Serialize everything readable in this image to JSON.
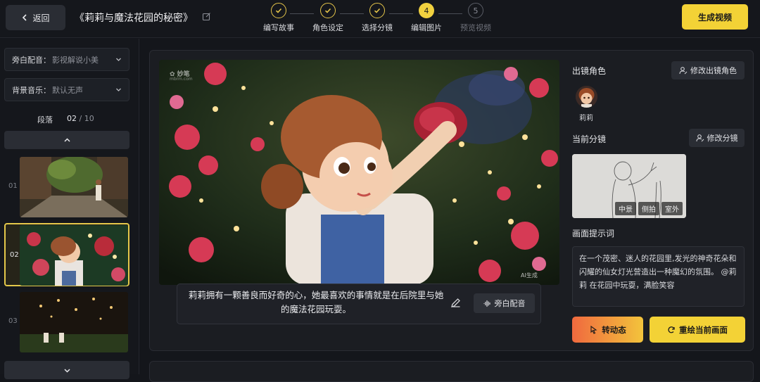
{
  "header": {
    "back_label": "返回",
    "title": "《莉莉与魔法花园的秘密》",
    "steps": [
      {
        "num": "",
        "label": "编写故事",
        "state": "done"
      },
      {
        "num": "",
        "label": "角色设定",
        "state": "done"
      },
      {
        "num": "",
        "label": "选择分镜",
        "state": "done"
      },
      {
        "num": "4",
        "label": "编辑图片",
        "state": "active"
      },
      {
        "num": "5",
        "label": "预览视频",
        "state": "todo"
      }
    ],
    "generate_label": "生成视频"
  },
  "sidebar": {
    "narration": {
      "key": "旁白配音：",
      "value": "影视解说小美"
    },
    "music": {
      "key": "背景音乐：",
      "value": "默认无声"
    },
    "segment_label": "段落",
    "segment_current": "02",
    "segment_total": " / 10",
    "thumbnails": [
      {
        "num": "01"
      },
      {
        "num": "02"
      },
      {
        "num": "03"
      }
    ]
  },
  "main": {
    "watermark_brand": "✿ 妙笔",
    "watermark_url": "mbrm.com",
    "ai_badge": "AI生成",
    "narration_text": "莉莉拥有一颗善良而好奇的心，她最喜欢的事情就是在后院里与她的魔法花园玩耍。",
    "voice_button": "旁白配音"
  },
  "panel": {
    "characters_title": "出镜角色",
    "modify_characters": "修改出镜角色",
    "character_name": "莉莉",
    "shot_title": "当前分镜",
    "modify_shot": "修改分镜",
    "shot_tags": [
      "中景",
      "侧拍",
      "室外"
    ],
    "prompt_title": "画面提示词",
    "prompt_text": "在一个茂密、迷人的花园里,发光的神奇花朵和闪耀的仙女灯光营造出一种魔幻的氛围。 @莉莉 在花园中玩耍，满脸笑容",
    "animate_button": "转动态",
    "redraw_button": "重绘当前画面"
  },
  "colors": {
    "accent": "#f3d236",
    "background": "#14161b",
    "card": "#1b1d22"
  }
}
